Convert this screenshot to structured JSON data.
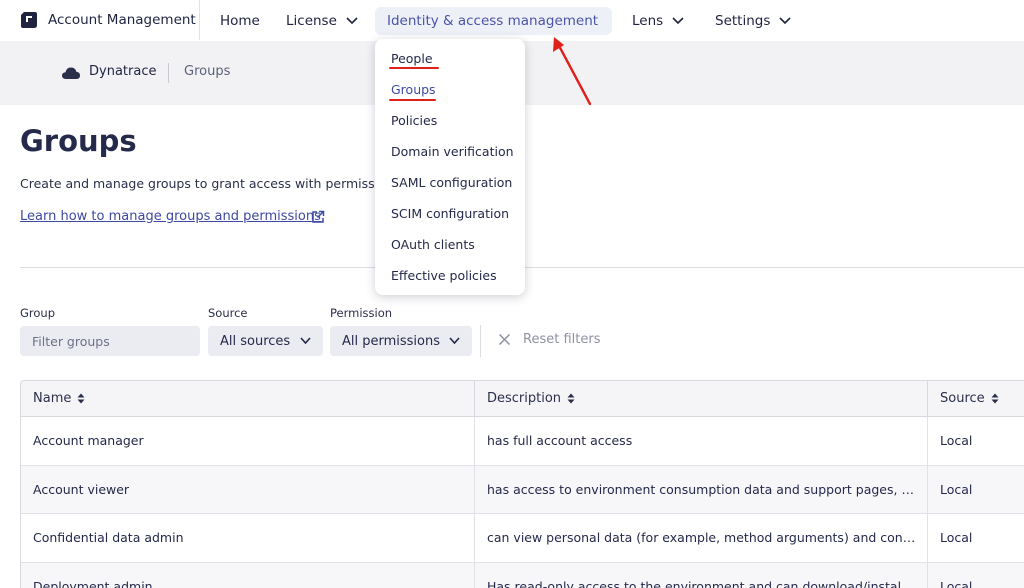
{
  "app": {
    "title": "Account Management"
  },
  "nav": {
    "items": [
      {
        "label": "Home"
      },
      {
        "label": "License"
      },
      {
        "label": "Identity & access management"
      },
      {
        "label": "Lens"
      },
      {
        "label": "Settings"
      }
    ],
    "active": "Identity & access management"
  },
  "dropdown": {
    "items": [
      {
        "label": "People"
      },
      {
        "label": "Groups"
      },
      {
        "label": "Policies"
      },
      {
        "label": "Domain verification"
      },
      {
        "label": "SAML configuration"
      },
      {
        "label": "SCIM configuration"
      },
      {
        "label": "OAuth clients"
      },
      {
        "label": "Effective policies"
      }
    ],
    "highlighted": [
      "People",
      "Groups"
    ]
  },
  "breadcrumb": {
    "home": "Dynatrace",
    "current": "Groups"
  },
  "page": {
    "title": "Groups",
    "description": "Create and manage groups to grant access with permissions",
    "learn_link": "Learn how to manage groups and permissions"
  },
  "filters": {
    "group_label": "Group",
    "group_placeholder": "Filter groups",
    "source_label": "Source",
    "source_value": "All sources",
    "permission_label": "Permission",
    "permission_value": "All permissions",
    "reset_label": "Reset filters"
  },
  "table": {
    "columns": [
      "Name",
      "Description",
      "Source"
    ],
    "rows": [
      {
        "name": "Account manager",
        "description": "has full account access",
        "source": "Local"
      },
      {
        "name": "Account viewer",
        "description": "has access to environment consumption data and support pages, but ...",
        "source": "Local"
      },
      {
        "name": "Confidential data admin",
        "description": "can view personal data (for example, method arguments) and config...",
        "source": "Local"
      },
      {
        "name": "Deployment admin",
        "description": "Has read-only access to the environment and can download/install O...",
        "source": "Local"
      }
    ]
  },
  "colors": {
    "accent": "#3d48a3",
    "annotation": "#e0211b",
    "band_bg": "#f2f2f5"
  }
}
